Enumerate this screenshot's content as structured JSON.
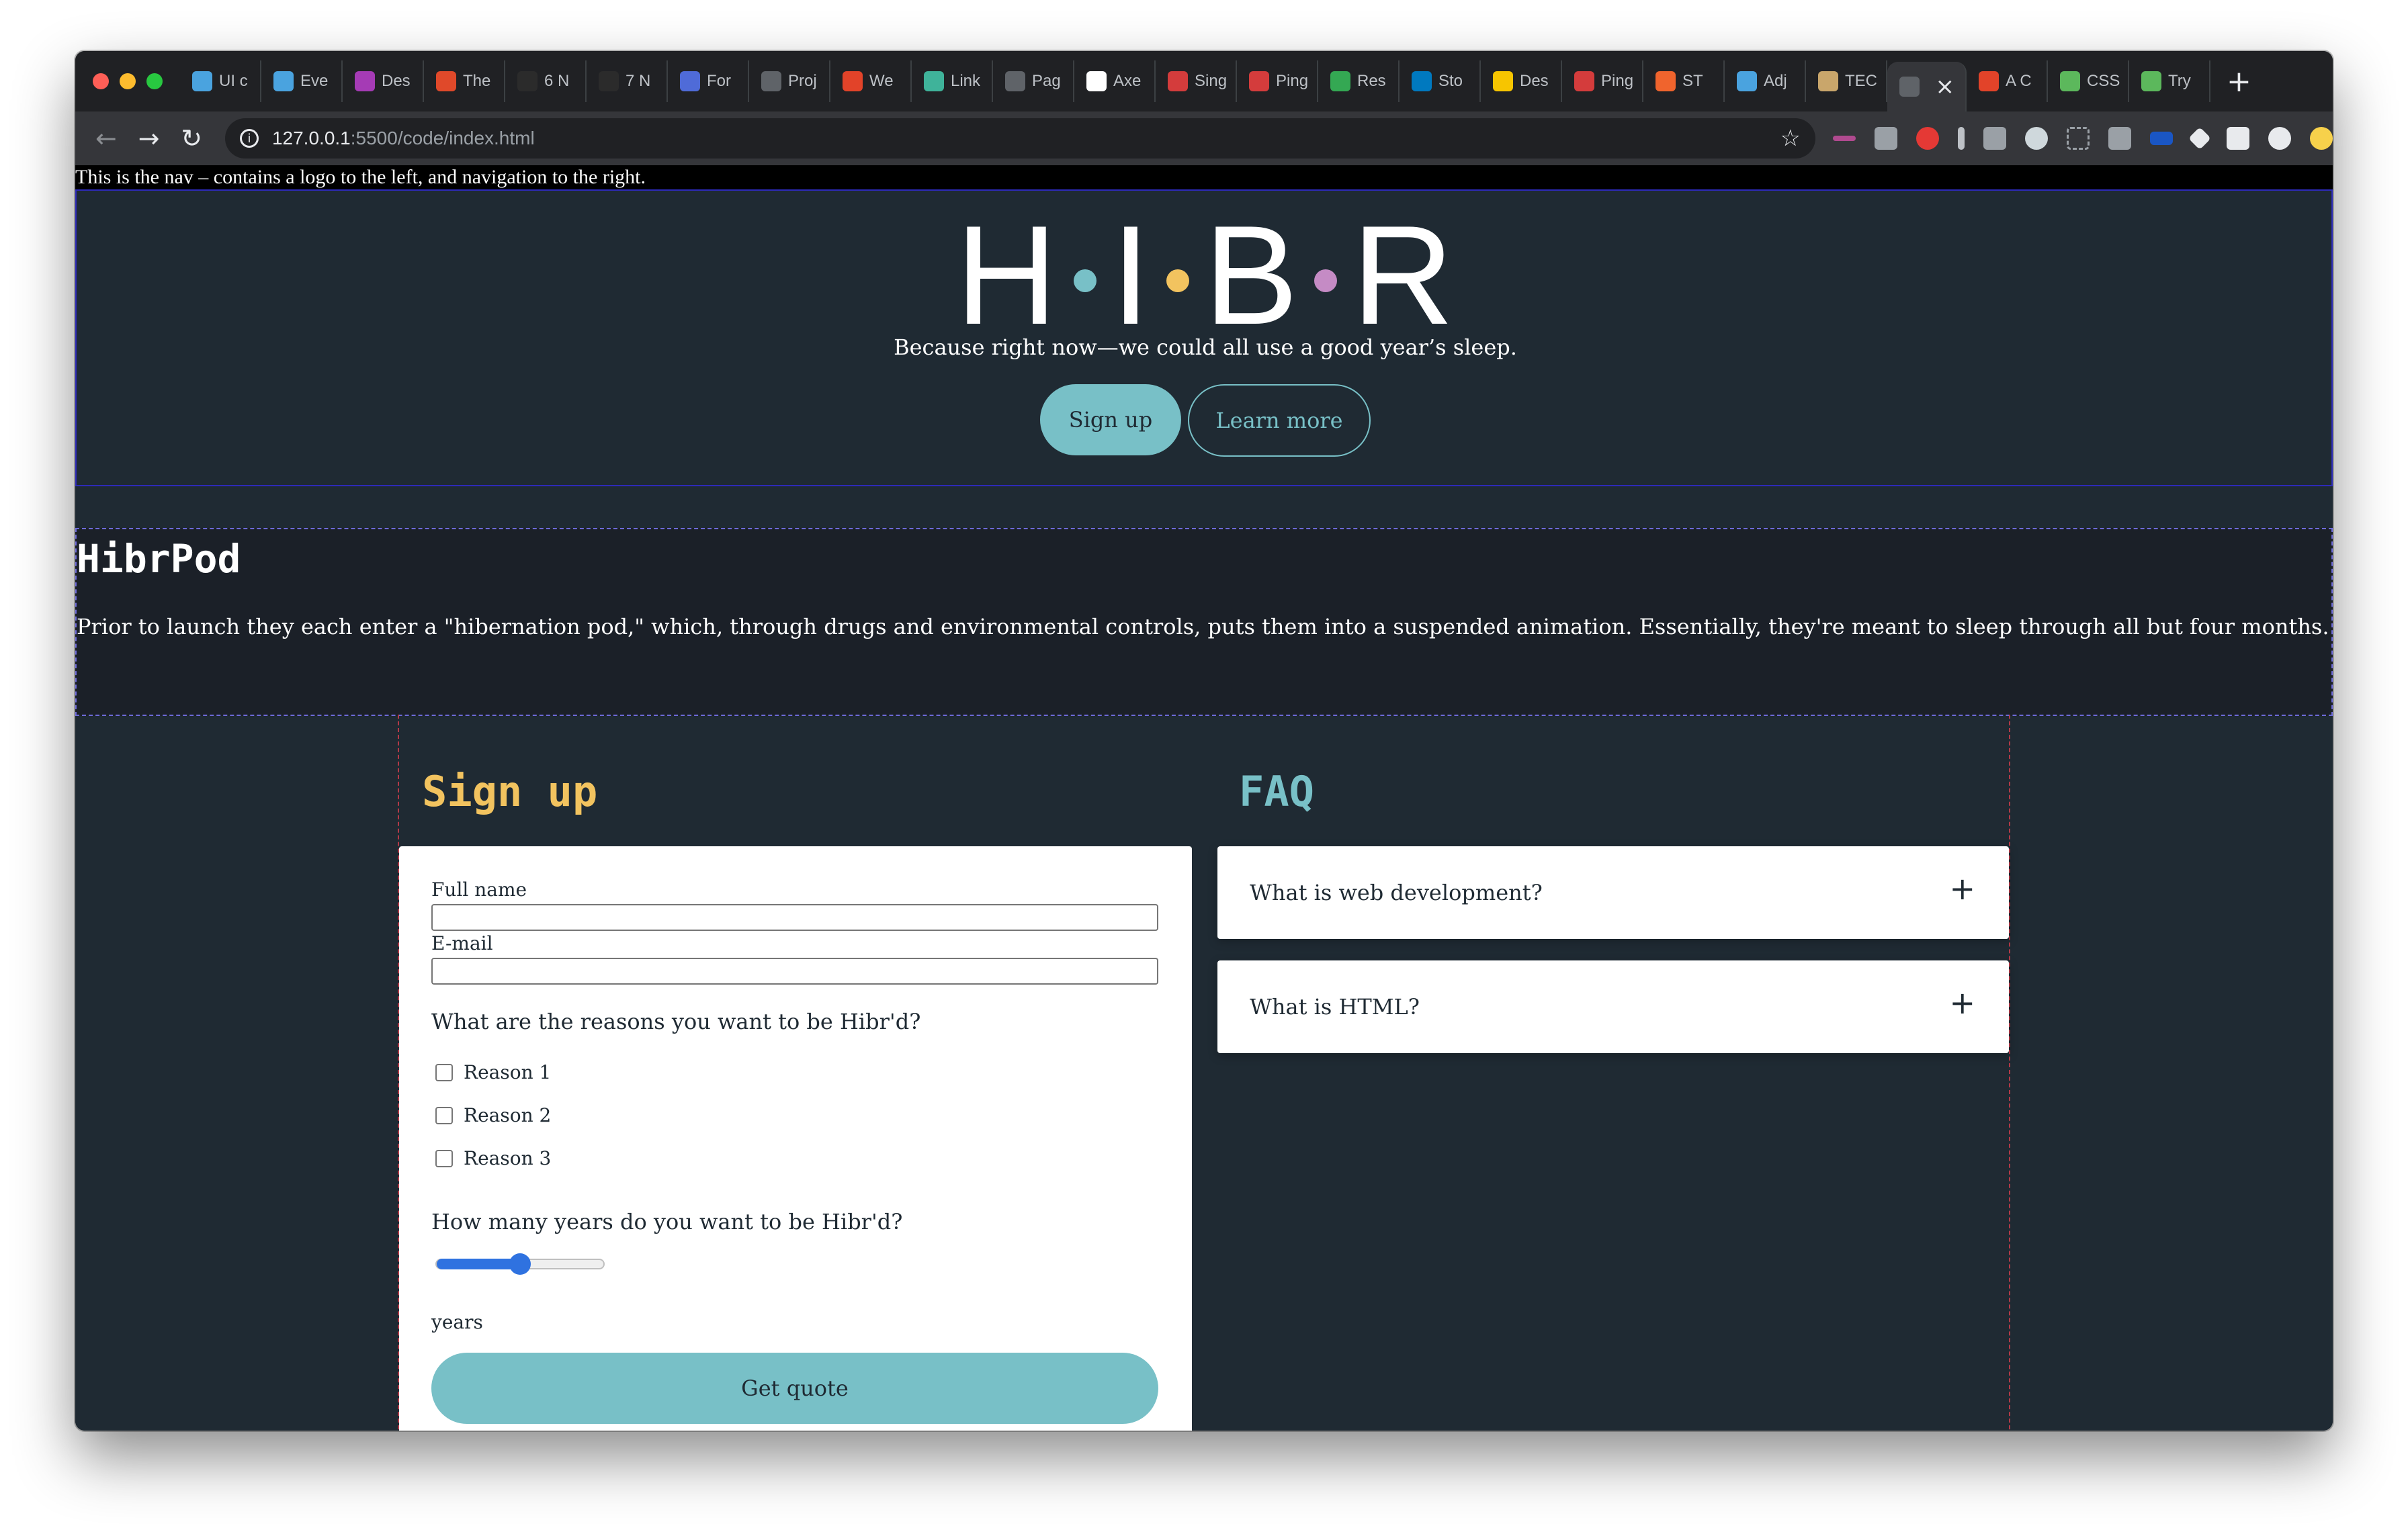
{
  "browser": {
    "tabs": [
      {
        "label": "UI c",
        "icon": "app-icon",
        "color": "#4aa3df"
      },
      {
        "label": "Eve",
        "icon": "app-icon",
        "color": "#4aa3df"
      },
      {
        "label": "Des",
        "icon": "app-icon",
        "color": "#a53bb5"
      },
      {
        "label": "The",
        "icon": "ux-icon",
        "color": "#e0492a"
      },
      {
        "label": "6 N",
        "icon": "medium-icon",
        "color": "#2b2b2b"
      },
      {
        "label": "7 N",
        "icon": "medium-icon",
        "color": "#2b2b2b"
      },
      {
        "label": "For",
        "icon": "app-icon",
        "color": "#4f6bd8"
      },
      {
        "label": "Proj",
        "icon": "globe-icon",
        "color": "#5f6368"
      },
      {
        "label": "We",
        "icon": "app-icon",
        "color": "#e24329"
      },
      {
        "label": "Link",
        "icon": "diamond-icon",
        "color": "#3fb39a"
      },
      {
        "label": "Pag",
        "icon": "globe-icon",
        "color": "#5f6368"
      },
      {
        "label": "Axe",
        "icon": "github-icon",
        "color": "#ffffff"
      },
      {
        "label": "Sing",
        "icon": "p1-icon",
        "color": "#d43c3c"
      },
      {
        "label": "Ping",
        "icon": "p1-icon",
        "color": "#d43c3c"
      },
      {
        "label": "Res",
        "icon": "drive-icon",
        "color": "#34a853"
      },
      {
        "label": "Sto",
        "icon": "trello-icon",
        "color": "#0079bf"
      },
      {
        "label": "Des",
        "icon": "miro-icon",
        "color": "#f7c500"
      },
      {
        "label": "Ping",
        "icon": "p1-icon",
        "color": "#d43c3c"
      },
      {
        "label": "ST",
        "icon": "app-icon",
        "color": "#f0642d"
      },
      {
        "label": "Adj",
        "icon": "app-icon",
        "color": "#4aa3df"
      },
      {
        "label": "TEC",
        "icon": "app-icon",
        "color": "#c9a66b"
      },
      {
        "label": "",
        "icon": "globe-icon",
        "color": "#5f6368",
        "active": true
      },
      {
        "label": "A C",
        "icon": "app-icon",
        "color": "#e24329"
      },
      {
        "label": "CSS",
        "icon": "app-icon",
        "color": "#5cb85c"
      },
      {
        "label": "Try",
        "icon": "app-icon",
        "color": "#5cb85c"
      }
    ],
    "url_host": "127.0.0.1",
    "url_path": ":5500/code/index.html"
  },
  "nav": {
    "text": "This is the nav – contains a logo to the left, and navigation to the right."
  },
  "hero": {
    "logo_letters": [
      "H",
      "I",
      "B",
      "R"
    ],
    "logo_dot_colors": [
      "#78c0c7",
      "#f2c35f",
      "#c58bc5"
    ],
    "tagline": "Because right now—we could all use a good year’s sleep.",
    "signup_label": "Sign up",
    "learn_more_label": "Learn more"
  },
  "about": {
    "title": "HibrPod",
    "text": "Prior to launch they each enter a \"hibernation pod,\" which, through drugs and environmental controls, puts them into a suspended animation. Essentially, they're meant to sleep through all but four months."
  },
  "signup": {
    "title": "Sign up",
    "full_name_label": "Full name",
    "full_name_value": "",
    "email_label": "E-mail",
    "email_value": "",
    "reasons_question": "What are the reasons you want to be Hibr'd?",
    "reasons": [
      {
        "label": "Reason 1",
        "checked": false
      },
      {
        "label": "Reason 2",
        "checked": false
      },
      {
        "label": "Reason 3",
        "checked": false
      }
    ],
    "years_question": "How many years do you want to be Hibr'd?",
    "years_slider_fraction": 0.5,
    "years_label": "years",
    "quote_button": "Get quote"
  },
  "faq": {
    "title": "FAQ",
    "items": [
      {
        "question": "What is web development?",
        "expand": "+"
      },
      {
        "question": "What is HTML?",
        "expand": "+"
      }
    ]
  },
  "colors": {
    "page_bg": "#1f2a33",
    "accent_teal": "#78c0c7",
    "accent_yellow": "#f2c35f",
    "accent_purple": "#c58bc5"
  }
}
